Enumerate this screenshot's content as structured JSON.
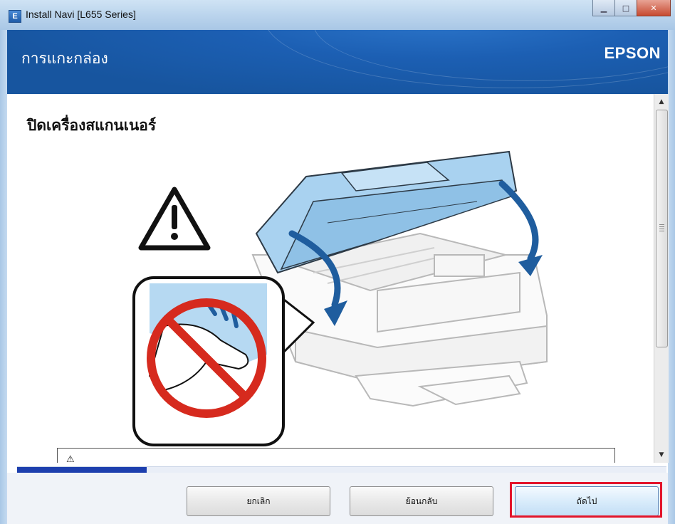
{
  "window": {
    "title": "Install Navi [L655 Series]",
    "app_icon_glyph": "E",
    "controls": {
      "minimize": "▁",
      "maximize": "□",
      "close": "✕"
    }
  },
  "header": {
    "title": "การแกะกล่อง",
    "brand": "EPSON"
  },
  "content": {
    "heading": "ปิดเครื่องสแกนเนอร์",
    "illustration_icons": [
      "warning-icon",
      "scanner-printer-illustration",
      "no-hand-prohibition-icon",
      "arrow-down-icon"
    ],
    "caution": {
      "icon": "⚠",
      "text": ""
    }
  },
  "scrollbar": {
    "up": "▲",
    "down": "▼",
    "position_fraction": 0.0
  },
  "progress": {
    "fraction": 0.2
  },
  "buttons": {
    "cancel": "ยกเลิก",
    "back": "ย้อนกลับ",
    "next": "ถัดไป"
  },
  "colors": {
    "header_blue": "#1c5fb3",
    "progress_blue": "#1d3fae",
    "highlight_red": "#e3142a",
    "scanner_blue": "#a9d2f0"
  }
}
